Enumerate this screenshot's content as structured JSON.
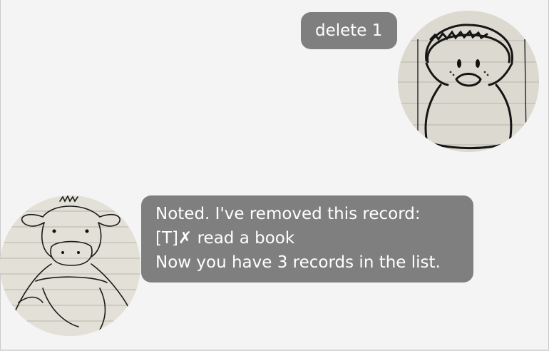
{
  "conversation": {
    "user_message": {
      "text": "delete 1",
      "avatar_icon": "penguin-sketch-avatar"
    },
    "bot_message": {
      "line1": "Noted. I've removed this record:",
      "line2_prefix": "[T]",
      "line2_mark": "✗",
      "line2_rest": " read a book",
      "line3": "Now you have 3 records in the list.",
      "avatar_icon": "cow-sketch-avatar"
    }
  },
  "colors": {
    "background": "#f4f4f4",
    "bubble": "#7f7f7f",
    "bubble_text": "#ffffff"
  }
}
